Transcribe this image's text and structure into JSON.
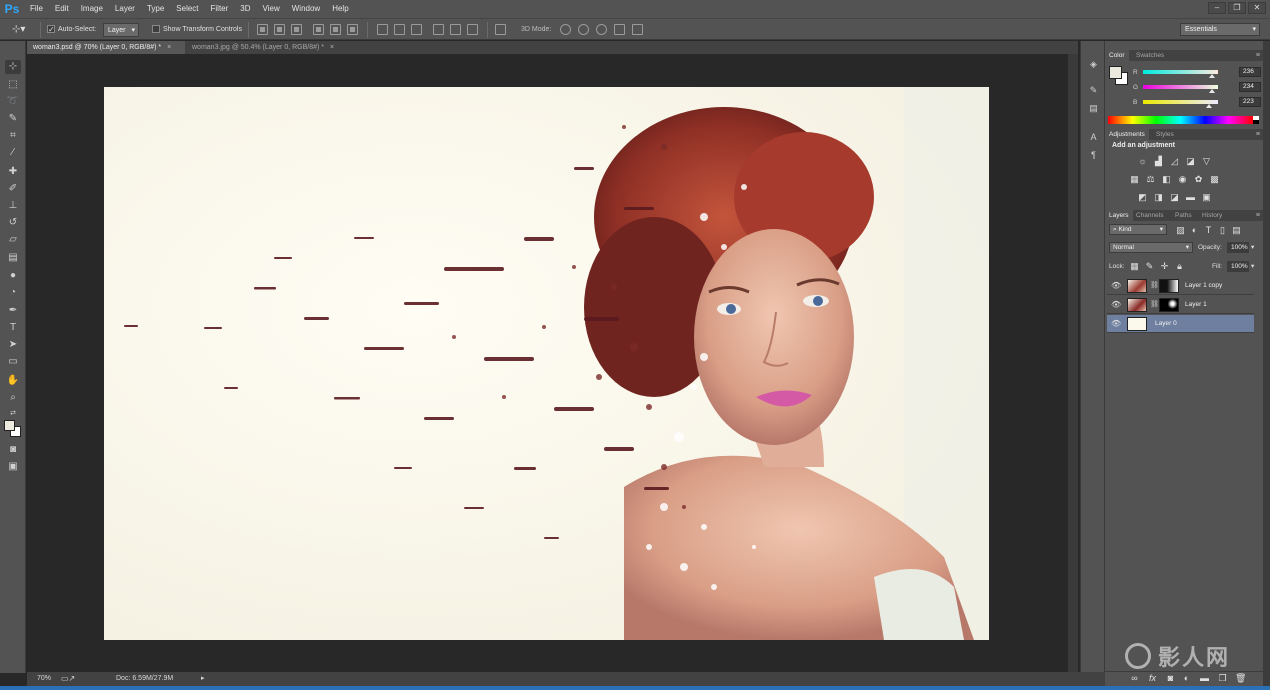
{
  "app": {
    "logo": "Ps"
  },
  "menu": [
    "File",
    "Edit",
    "Image",
    "Layer",
    "Type",
    "Select",
    "Filter",
    "3D",
    "View",
    "Window",
    "Help"
  ],
  "window_controls": [
    "–",
    "❐",
    "✕"
  ],
  "options": {
    "auto_select_label": "Auto-Select:",
    "auto_select_checked": true,
    "auto_select_value": "Layer",
    "show_transform_label": "Show Transform Controls",
    "mode_3d_label": "3D Mode:"
  },
  "workspace": "Essentials",
  "doc_tabs": [
    {
      "label": "woman3.psd @ 70% (Layer 0, RGB/8#) *",
      "active": true
    },
    {
      "label": "woman3.jpg @ 50.4% (Layer 0, RGB/8#) *",
      "active": false
    }
  ],
  "status": {
    "zoom": "70%",
    "doc": "Doc: 6.59M/27.9M"
  },
  "color_panel": {
    "tabs": [
      "Color",
      "Swatches"
    ],
    "r_label": "R",
    "g_label": "G",
    "b_label": "B",
    "r": "236",
    "g": "234",
    "b": "223",
    "r_level": 0.925,
    "g_level": 0.918,
    "b_level": 0.875,
    "foreground": "#ECEADF"
  },
  "adjustments_panel": {
    "tabs": [
      "Adjustments",
      "Styles"
    ],
    "heading": "Add an adjustment"
  },
  "layers_panel": {
    "tabs": [
      "Layers",
      "Channels",
      "Paths",
      "History"
    ],
    "filter_kind": "Kind",
    "blend_mode": "Normal",
    "opacity_label": "Opacity:",
    "opacity": "100%",
    "lock_label": "Lock:",
    "fill_label": "Fill:",
    "fill": "100%",
    "layers": [
      {
        "name": "Layer 1 copy",
        "selected": false,
        "masked": true
      },
      {
        "name": "Layer 1",
        "selected": false,
        "masked": true
      },
      {
        "name": "Layer 0",
        "selected": true,
        "masked": false
      }
    ]
  },
  "watermark": "影人网",
  "accent": "#6E7FA0"
}
